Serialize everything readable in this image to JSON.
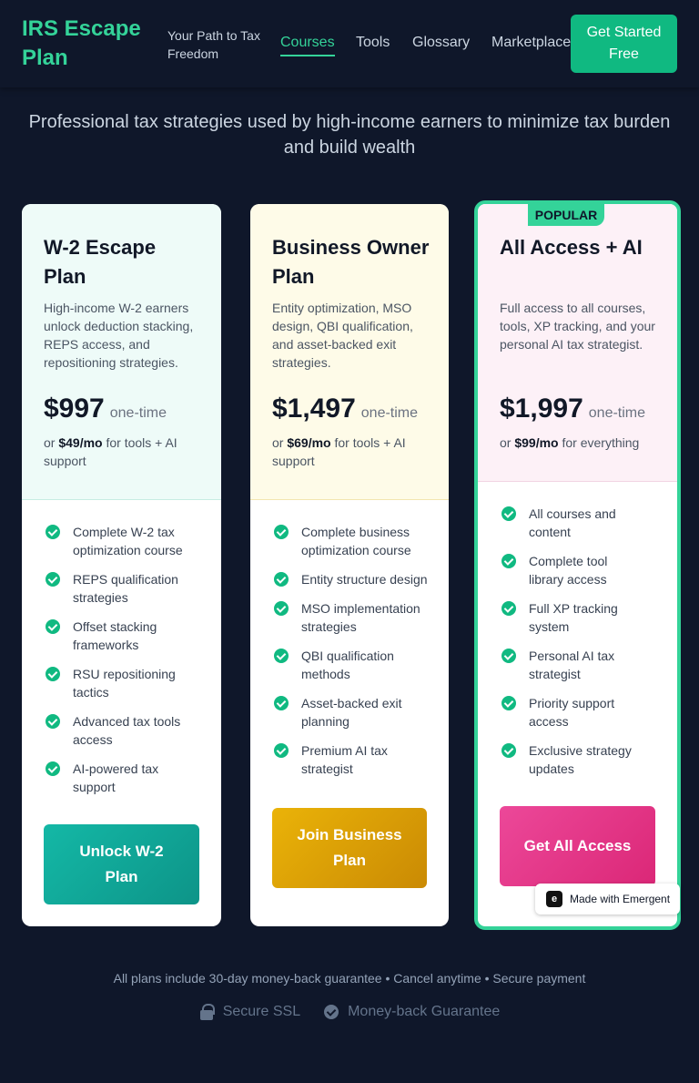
{
  "header": {
    "brand": "IRS Escape Plan",
    "tagline": "Your Path to Tax Freedom",
    "nav": [
      "Courses",
      "Tools",
      "Glossary",
      "Marketplace"
    ],
    "active_nav": "Courses",
    "cta": "Get Started Free"
  },
  "intro": "Professional tax strategies used by high-income earners to minimize tax burden and build wealth",
  "plans": [
    {
      "title": "W-2 Escape Plan",
      "description": "High-income W-2 earners unlock deduction stacking, REPS access, and repositioning strategies.",
      "price": "$997",
      "price_unit": "one-time",
      "alt_prefix": "or",
      "alt_price": "$49/mo",
      "alt_suffix": "for tools + AI support",
      "features": [
        "Complete W-2 tax optimization course",
        "REPS qualification strategies",
        "Offset stacking frameworks",
        "RSU repositioning tactics",
        "Advanced tax tools access",
        "AI-powered tax support"
      ],
      "button": "Unlock W-2 Plan",
      "accent": "#14b8a6"
    },
    {
      "title": "Business Owner Plan",
      "description": "Entity optimization, MSO design, QBI qualification, and asset-backed exit strategies.",
      "price": "$1,497",
      "price_unit": "one-time",
      "alt_prefix": "or",
      "alt_price": "$69/mo",
      "alt_suffix": "for tools + AI support",
      "features": [
        "Complete business optimization course",
        "Entity structure design",
        "MSO implementation strategies",
        "QBI qualification methods",
        "Asset-backed exit planning",
        "Premium AI tax strategist"
      ],
      "button": "Join Business Plan",
      "accent": "#eab308"
    },
    {
      "badge": "POPULAR",
      "title": "All Access + AI",
      "description": "Full access to all courses, tools, XP tracking, and your personal AI tax strategist.",
      "price": "$1,997",
      "price_unit": "one-time",
      "alt_prefix": "or",
      "alt_price": "$99/mo",
      "alt_suffix": "for everything",
      "features": [
        "All courses and content",
        "Complete tool library access",
        "Full XP tracking system",
        "Personal AI tax strategist",
        "Priority support access",
        "Exclusive strategy updates"
      ],
      "button": "Get All Access",
      "accent": "#ec4899"
    }
  ],
  "made_with": "Made with Emergent",
  "footer": {
    "guarantee": "All plans include 30-day money-back guarantee • Cancel anytime • Secure payment",
    "trust": [
      "Secure SSL",
      "Money-back Guarantee"
    ]
  }
}
